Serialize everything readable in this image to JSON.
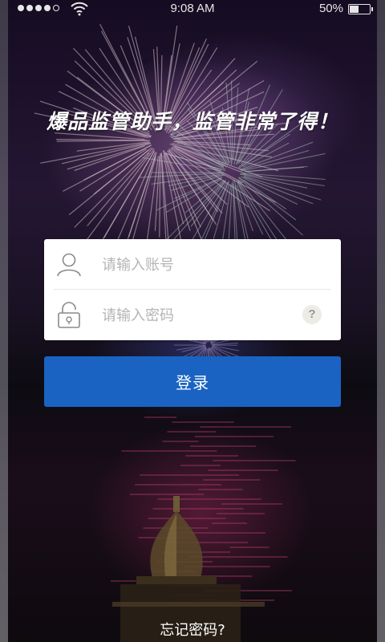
{
  "status_bar": {
    "signal_full": 4,
    "signal_total": 5,
    "time": "9:08 AM",
    "battery_text": "50%",
    "battery_level": 0.5
  },
  "slogan": "爆品监管助手，监管非常了得！",
  "login_form": {
    "account_placeholder": "请输入账号",
    "account_icon": "user-icon",
    "password_placeholder": "请输入密码",
    "password_icon": "lock-icon",
    "help_label": "?"
  },
  "login_button": {
    "label": "登录"
  },
  "forgot_password": {
    "label": "忘记密码?"
  },
  "colors": {
    "primary_button": "#1a63c3",
    "card_background": "#ffffff",
    "placeholder_text": "#b4b4b4"
  }
}
